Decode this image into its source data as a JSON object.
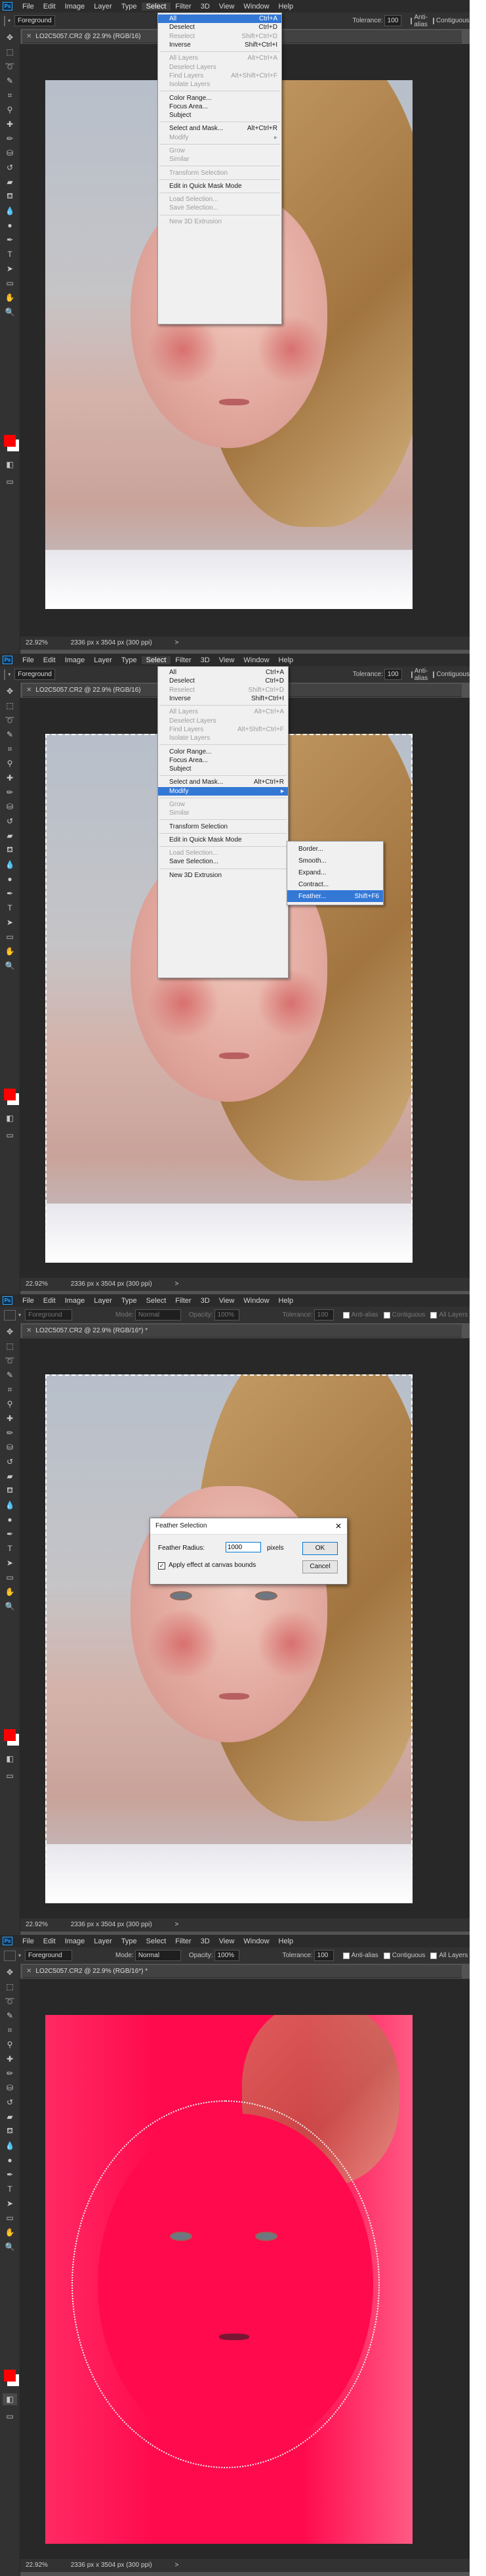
{
  "menubar": {
    "logo": "Ps",
    "items": [
      "File",
      "Edit",
      "Image",
      "Layer",
      "Type",
      "Select",
      "Filter",
      "3D",
      "View",
      "Window",
      "Help"
    ]
  },
  "options": {
    "sample_value": "Foreground",
    "mode_label": "Mode:",
    "mode_value": "Normal",
    "opacity_label": "Opacity:",
    "opacity_value": "100%",
    "tolerance_label": "Tolerance:",
    "tolerance_value": "100",
    "antialias_label": "Anti-alias",
    "contiguous_label": "Contiguous",
    "all_layers_label": "All Layers"
  },
  "document": {
    "tab_title_1": "LO2C5057.CR2 @ 22.9% (RGB/16)",
    "tab_title_2": "LO2C5057.CR2 @ 22.9% (RGB/16*) *",
    "zoom": "22.92%",
    "dimensions": "2336 px x 3504 px (300 ppi)",
    "status_arrow": ">"
  },
  "select_menu": {
    "all": {
      "label": "All",
      "shortcut": "Ctrl+A"
    },
    "deselect": {
      "label": "Deselect",
      "shortcut": "Ctrl+D"
    },
    "reselect": {
      "label": "Reselect",
      "shortcut": "Shift+Ctrl+D"
    },
    "inverse": {
      "label": "Inverse",
      "shortcut": "Shift+Ctrl+I"
    },
    "all_layers": {
      "label": "All Layers",
      "shortcut": "Alt+Ctrl+A"
    },
    "deselect_layers": {
      "label": "Deselect Layers"
    },
    "find_layers": {
      "label": "Find Layers",
      "shortcut": "Alt+Shift+Ctrl+F"
    },
    "isolate_layers": {
      "label": "Isolate Layers"
    },
    "color_range": {
      "label": "Color Range..."
    },
    "focus_area": {
      "label": "Focus Area..."
    },
    "subject": {
      "label": "Subject"
    },
    "select_and_mask": {
      "label": "Select and Mask...",
      "shortcut": "Alt+Ctrl+R"
    },
    "modify": {
      "label": "Modify",
      "arrow": "▸"
    },
    "grow": {
      "label": "Grow"
    },
    "similar": {
      "label": "Similar"
    },
    "transform_selection": {
      "label": "Transform Selection"
    },
    "quick_mask": {
      "label": "Edit in Quick Mask Mode"
    },
    "load_selection": {
      "label": "Load Selection..."
    },
    "save_selection": {
      "label": "Save Selection..."
    },
    "new_3d_extrusion": {
      "label": "New 3D Extrusion"
    }
  },
  "modify_menu": {
    "border": "Border...",
    "smooth": "Smooth...",
    "expand": "Expand...",
    "contract": "Contract...",
    "feather": {
      "label": "Feather...",
      "shortcut": "Shift+F6"
    }
  },
  "feather_dialog": {
    "title": "Feather Selection",
    "close": "✕",
    "radius_label": "Feather Radius:",
    "radius_value": "1000",
    "unit": "pixels",
    "apply_label": "Apply effect at canvas bounds",
    "ok": "OK",
    "cancel": "Cancel"
  },
  "colors": {
    "foreground": "#ff0000",
    "background": "#ffffff",
    "menu_highlight": "#3478d6",
    "quickmask": "#ff0a4d"
  },
  "tools": [
    "move-icon",
    "marquee-icon",
    "lasso-icon",
    "quick-select-icon",
    "crop-icon",
    "eyedropper-icon",
    "healing-icon",
    "brush-icon",
    "stamp-icon",
    "history-brush-icon",
    "eraser-icon",
    "gradient-icon",
    "blur-icon",
    "dodge-icon",
    "pen-icon",
    "type-icon",
    "path-select-icon",
    "shape-icon",
    "hand-icon",
    "zoom-icon"
  ]
}
